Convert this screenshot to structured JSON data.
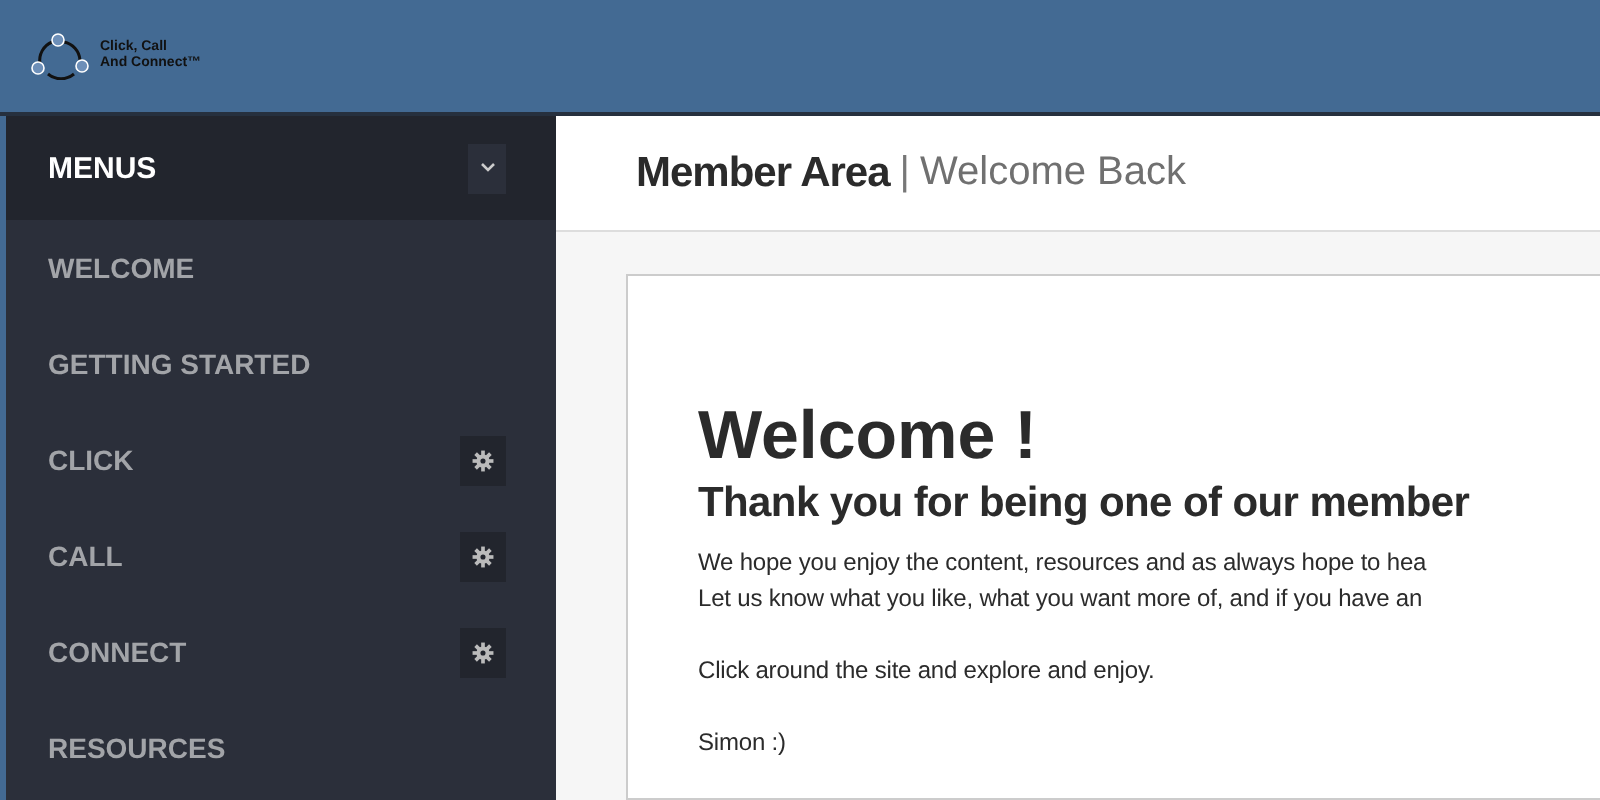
{
  "header": {
    "logo_text": [
      "Click, Call",
      "And Connect™"
    ]
  },
  "sidebar": {
    "title": "MENUS",
    "expanded": true,
    "items": [
      {
        "label": "WELCOME",
        "has_settings": false
      },
      {
        "label": "GETTING STARTED",
        "has_settings": false
      },
      {
        "label": "CLICK",
        "has_settings": true
      },
      {
        "label": "CALL",
        "has_settings": true
      },
      {
        "label": "CONNECT",
        "has_settings": true
      },
      {
        "label": "RESOURCES",
        "has_settings": false
      }
    ]
  },
  "page_header": {
    "title": "Member Area",
    "separator": "|",
    "subtitle": "Welcome Back"
  },
  "content": {
    "heading": "Welcome !",
    "subheading": "Thank you for being one of our member",
    "paragraphs": [
      [
        "We hope you enjoy the content, resources and as always hope to hea",
        "Let us know what you like, what you want more of, and if you have an"
      ],
      [
        "Click around the site and explore and enjoy."
      ],
      [
        "Simon :)"
      ]
    ]
  }
}
